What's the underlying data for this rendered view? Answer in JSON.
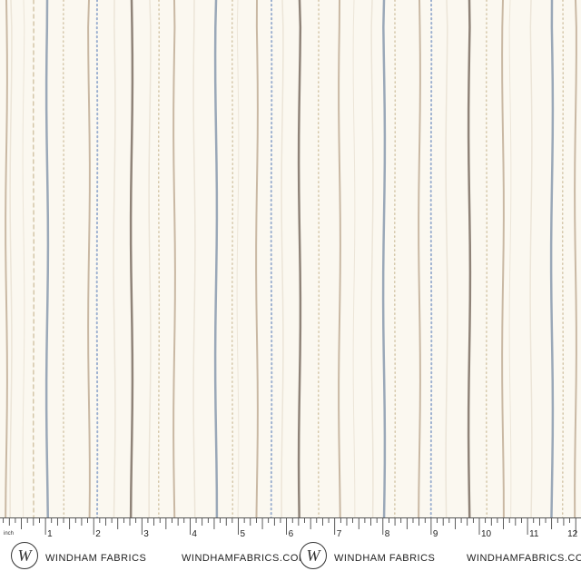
{
  "fabric": {
    "background": "#fbf8f0",
    "colors": {
      "blue": "#9aa8b8",
      "brown": "#8f8378",
      "tan": "#c9b8a3",
      "pale": "#ece5d8",
      "dotBlue": "#9cb0d0",
      "dotTan": "#d4c6a8"
    }
  },
  "ruler": {
    "unit_label": "inch",
    "numbers": [
      "1",
      "2",
      "3",
      "4",
      "5",
      "6",
      "7",
      "8",
      "9",
      "10",
      "11",
      "12"
    ],
    "logo_letter": "W",
    "brand_name": "WINDHAM FABRICS",
    "website": "WINDHAMFABRICS.COM"
  }
}
